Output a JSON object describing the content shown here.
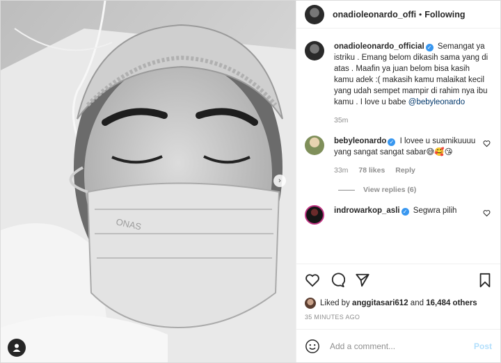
{
  "post": {
    "username": "onadioleonardo_official",
    "header_username": "onadioleonardo_officia",
    "dot": "•",
    "follow_label": "Following",
    "caption": "Semangat ya istriku . Emang belom dikasih sama yang di atas . Maafin ya juan belom bisa kasih kamu adek :( makasih kamu malaikat kecil yang udah sempet mampir di rahim nya ibu kamu . I love u babe",
    "caption_mention": "@bebyleonardo",
    "caption_time": "35m",
    "photo_mask_text": "ONAS",
    "carousel_indicator": "›"
  },
  "comments": [
    {
      "username": "bebyleonardo",
      "text": "I lovee u suamikuuuu yang sangat sangat sabar😅🥰😘",
      "time": "33m",
      "likes": "78 likes",
      "reply_label": "Reply",
      "view_replies": "View replies (6)"
    },
    {
      "username": "indrowarkop_asli",
      "text": "Segwra pilih"
    }
  ],
  "likes": {
    "prefix": "Liked by",
    "user": "anggitasari612",
    "middle": "and",
    "count": "16,484 others"
  },
  "timestamp": "35 MINUTES AGO",
  "composer": {
    "placeholder": "Add a comment...",
    "post_label": "Post"
  },
  "colors": {
    "verified": "#3897f0",
    "mention": "#00376b",
    "muted": "#8e8e8e",
    "post_disabled": "#b2dffc"
  }
}
